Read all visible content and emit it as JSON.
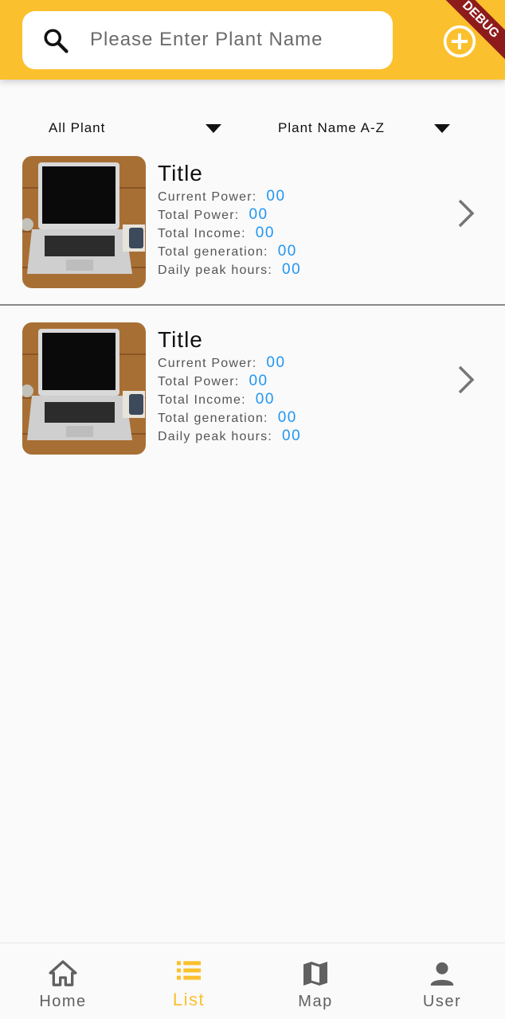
{
  "colors": {
    "header_bg": "#fbc02d",
    "accent": "#fbc02d",
    "value_blue": "#2196f3",
    "ribbon": "#8e1b1b"
  },
  "header": {
    "search_placeholder": "Please Enter Plant Name",
    "search_icon": "search-icon",
    "add_icon": "add-circle-icon",
    "debug_ribbon": "DEBUG"
  },
  "filters": {
    "plant_filter": "All Plant",
    "sort_order": "Plant Name A-Z"
  },
  "plants": [
    {
      "title": "Title",
      "current_power_label": "Current Power:",
      "current_power": "00",
      "total_power_label": "Total Power:",
      "total_power": "00",
      "total_income_label": "Total Income:",
      "total_income": "00",
      "total_generation_label": "Total generation:",
      "total_generation": "00",
      "daily_peak_hours_label": "Daily peak hours:",
      "daily_peak_hours": "00"
    },
    {
      "title": "Title",
      "current_power_label": "Current Power:",
      "current_power": "00",
      "total_power_label": "Total Power:",
      "total_power": "00",
      "total_income_label": "Total Income:",
      "total_income": "00",
      "total_generation_label": "Total generation:",
      "total_generation": "00",
      "daily_peak_hours_label": "Daily peak hours:",
      "daily_peak_hours": "00"
    }
  ],
  "bottom_nav": [
    {
      "label": "Home",
      "icon": "home-icon",
      "active": false
    },
    {
      "label": "List",
      "icon": "list-icon",
      "active": true
    },
    {
      "label": "Map",
      "icon": "map-icon",
      "active": false
    },
    {
      "label": "User",
      "icon": "user-icon",
      "active": false
    }
  ]
}
